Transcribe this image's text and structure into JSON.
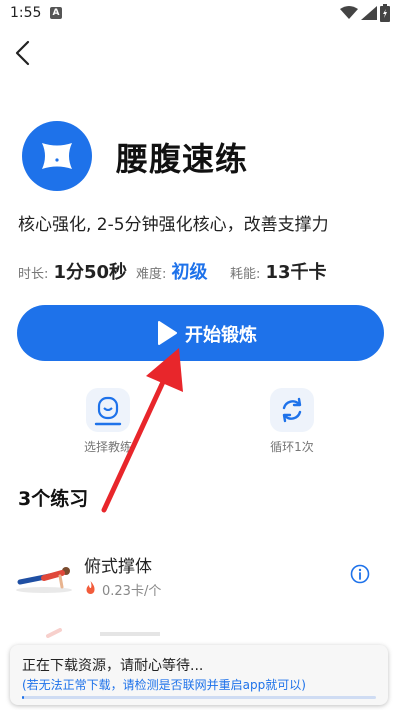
{
  "status_bar": {
    "time": "1:55"
  },
  "header": {
    "title": "腰腹速练",
    "subtitle": "核心强化, 2-5分钟强化核心，改善支撑力"
  },
  "stats": {
    "duration_label": "时长:",
    "duration_value": "1分50秒",
    "difficulty_label": "难度:",
    "difficulty_value": "初级",
    "calories_label": "耗能:",
    "calories_value": "13千卡"
  },
  "start_button": {
    "label": "开始锻炼"
  },
  "options": {
    "coach_label": "选择教练",
    "loop_label": "循环1次"
  },
  "section": {
    "title": "3个练习"
  },
  "exercises": [
    {
      "name": "俯式撑体",
      "calories": "0.23卡/个"
    }
  ],
  "toast": {
    "message": "正在下载资源，请耐心等待...",
    "hint": "(若无法正常下载，请检测是否联网并重启app就可以)",
    "progress": 0.005
  },
  "colors": {
    "accent": "#1e72ea",
    "annotation_arrow": "#e8262b",
    "fire": "#f25c3b"
  },
  "icons": {
    "back": "chevron-left-icon",
    "logo": "waist-icon",
    "play": "play-icon",
    "coach": "coach-icon",
    "loop": "loop-icon",
    "fire": "fire-icon",
    "info": "info-icon"
  }
}
